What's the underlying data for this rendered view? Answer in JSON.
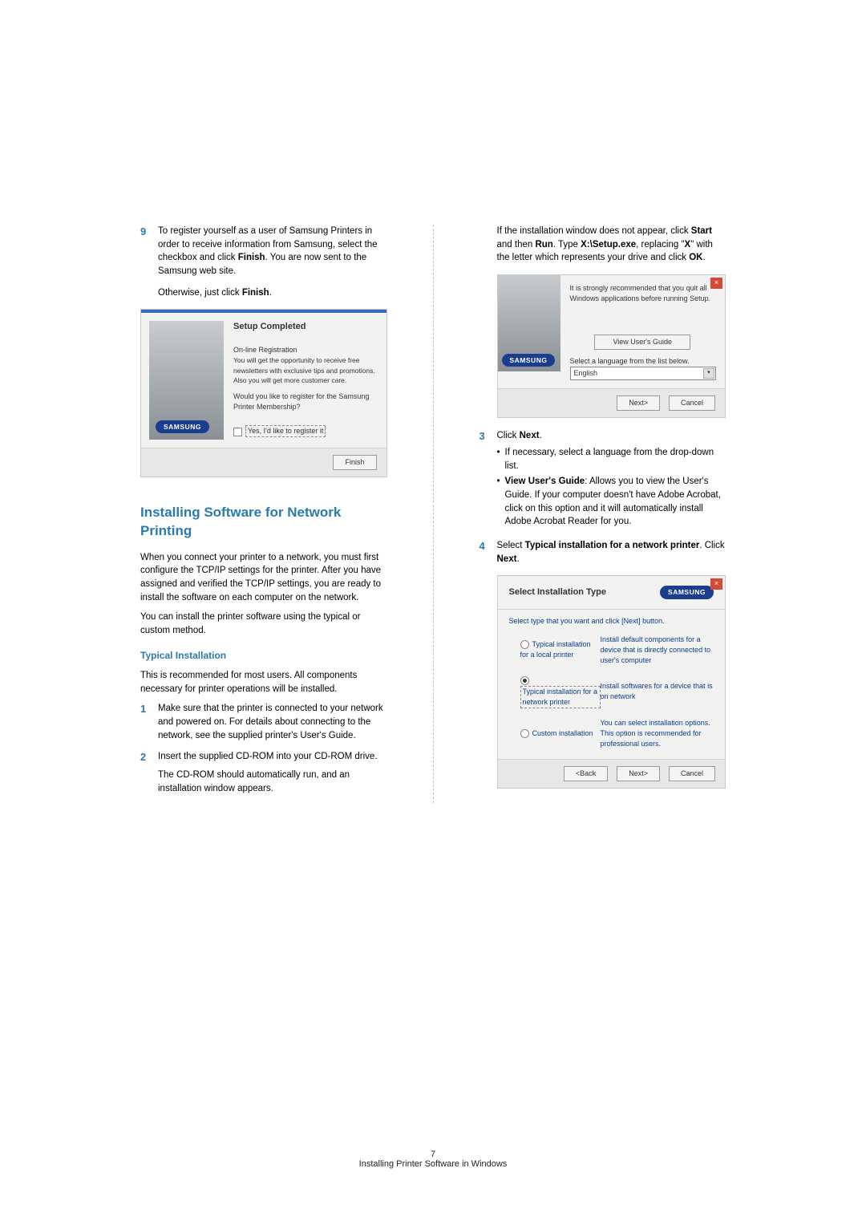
{
  "left": {
    "step9_num": "9",
    "step9_p1a": "To register yourself as a user of Samsung Printers in order to receive information from Samsung, select the checkbox and click ",
    "step9_p1b": "Finish",
    "step9_p1c": ". You are now sent to the Samsung web site.",
    "step9_p2a": "Otherwise, just click ",
    "step9_p2b": "Finish",
    "step9_p2c": ".",
    "dlgA": {
      "title": "Setup Completed",
      "line1": "On-line Registration",
      "line2": "You will get the opportunity to receive free newsletters with exclusive tips and promotions. Also you will get more customer care.",
      "line3": "Would you like to register for the Samsung Printer Membership?",
      "check": "Yes, I'd like to register it",
      "finish": "Finish",
      "badge": "SAMSUNG"
    },
    "h2": "Installing Software for Network Printing",
    "para1": "When you connect your printer to a network, you must first configure the TCP/IP settings for the printer. After you have assigned and verified the TCP/IP settings, you are ready to install the software on each computer on the network.",
    "para2": "You can install the printer software using the typical or custom method.",
    "h3": "Typical Installation",
    "para3": "This is recommended for most users. All components necessary for printer operations will be installed.",
    "step1_num": "1",
    "step1": "Make sure that the printer is connected to your network and powered on. For details about connecting to the network, see the supplied printer's User's Guide.",
    "step2_num": "2",
    "step2a": "Insert the supplied CD-ROM into your CD-ROM drive.",
    "step2b": "The CD-ROM should automatically run, and an installation window appears."
  },
  "right": {
    "para1a": "If the installation window does not appear, click ",
    "para1b": "Start",
    "para1c": " and then ",
    "para1d": "Run",
    "para1e": ". Type ",
    "para1f": "X:\\Setup.exe",
    "para1g": ", replacing \"",
    "para1h": "X",
    "para1i": "\" with the letter which represents your drive and click ",
    "para1j": "OK",
    "para1k": ".",
    "dlgB": {
      "line1": "It is strongly recommended that you quit all Windows applications before running Setup.",
      "viewguide": "View User's Guide",
      "selectlang": "Select a language from the list below.",
      "lang": "English",
      "badge": "SAMSUNG",
      "next": "Next>",
      "cancel": "Cancel"
    },
    "step3_num": "3",
    "step3_p1a": "Click ",
    "step3_p1b": "Next",
    "step3_p1c": ".",
    "step3_b1": "If necessary, select a language from the drop-down list.",
    "step3_b2a": "View User's Guide",
    "step3_b2b": ": Allows you to view the User's Guide. If your computer doesn't have Adobe Acrobat, click on this option and it will automatically install Adobe Acrobat Reader for you.",
    "step4_num": "4",
    "step4a": "Select ",
    "step4b": "Typical installation for a network printer",
    "step4c": ". Click ",
    "step4d": "Next",
    "step4e": ".",
    "dlgC": {
      "title": "Select Installation Type",
      "hint": "Select type that you want and click [Next] button.",
      "opt1": "Typical installation for a local printer",
      "opt1d": "Install default components for a device that is directly connected to user's computer",
      "opt2": "Typical installation for a network printer",
      "opt2d": "Install softwares for a device that is on network",
      "opt3": "Custom installation",
      "opt3d": "You can select installation options. This option is recommended for professional users.",
      "badge": "SAMSUNG",
      "back": "<Back",
      "next": "Next>",
      "cancel": "Cancel"
    }
  },
  "footer": {
    "pageno": "7",
    "title": "Installing Printer Software in Windows"
  }
}
